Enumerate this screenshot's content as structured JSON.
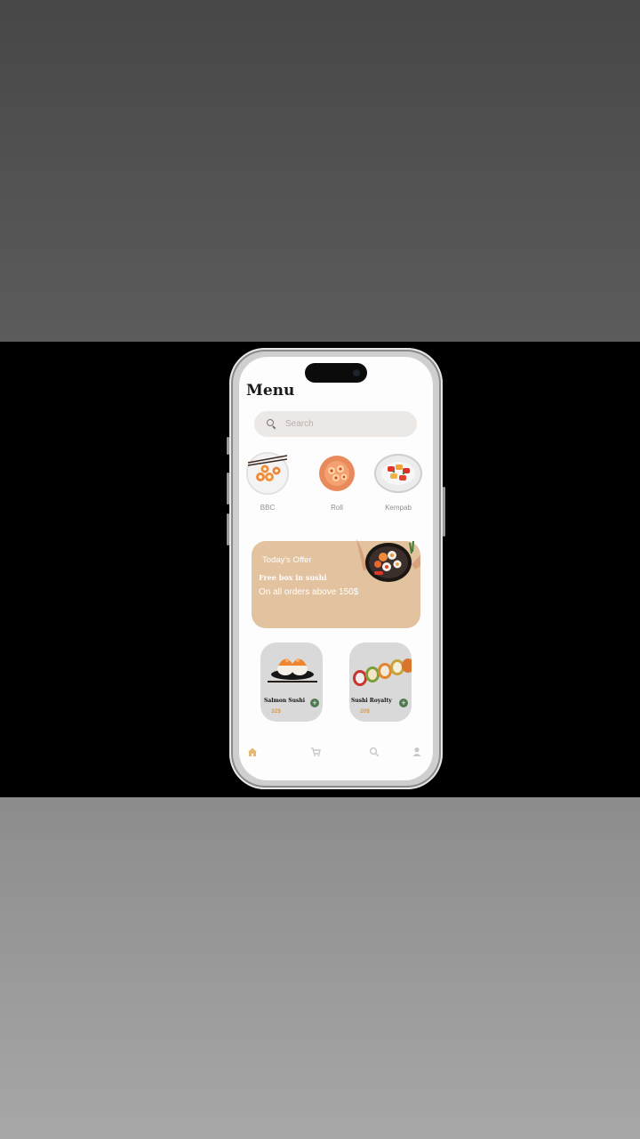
{
  "header": {
    "title": "Menu"
  },
  "search": {
    "placeholder": "Search"
  },
  "categories": [
    {
      "label": "BBC",
      "icon": "sushi-plate-icon"
    },
    {
      "label": "Roll",
      "icon": "roll-plate-icon"
    },
    {
      "label": "Kempab",
      "icon": "kempab-plate-icon"
    }
  ],
  "offer": {
    "heading": "Today's Offer",
    "headline": "Free box in sushi",
    "subtext": "On all orders above  150$"
  },
  "products": [
    {
      "name": "Salmon Sushi",
      "price": "32$",
      "add_label": "+"
    },
    {
      "name": "Sushi Royalty",
      "price": "20$",
      "add_label": "+"
    }
  ],
  "nav": {
    "items": [
      "home-icon",
      "cart-icon",
      "search-icon",
      "profile-icon"
    ],
    "active_color": "#e8b872",
    "inactive_color": "#c8c8c8"
  },
  "colors": {
    "accent": "#e3c39f",
    "price": "#e39a3a",
    "add_button": "#4f7a50"
  }
}
